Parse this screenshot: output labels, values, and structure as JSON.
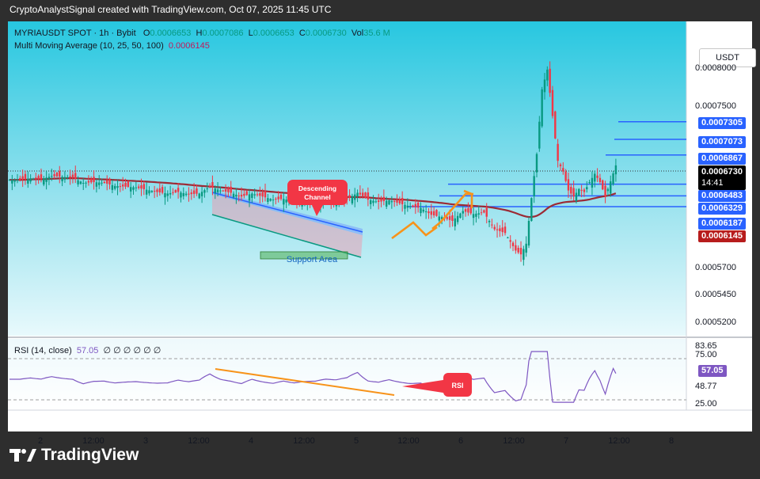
{
  "header": {
    "text": "CryptoAnalystSignal created with TradingView.com, Oct 07, 2025 11:45 UTC"
  },
  "footer": {
    "brand": "TradingView"
  },
  "legend": {
    "symbol": "MYRIAUSDT SPOT · 1h · Bybit",
    "o_label": "O",
    "o_value": "0.0006653",
    "h_label": "H",
    "h_value": "0.0007086",
    "l_label": "L",
    "l_value": "0.0006653",
    "c_label": "C",
    "c_value": "0.0006730",
    "vol_label": "Vol",
    "vol_value": "35.6 M",
    "ma_name": "Multi Moving Average (10, 25, 50, 100)",
    "ma_value": "0.0006145",
    "rsi_name": "RSI (14, close)",
    "rsi_value": "57.05",
    "rsi_extra": "∅ ∅ ∅ ∅ ∅ ∅"
  },
  "currency_button": "USDT",
  "price_axis": [
    "0.0008000",
    "0.0007500",
    "0.0005700",
    "0.0005450",
    "0.0005200"
  ],
  "price_tags": {
    "l1": "0.0007305",
    "l2": "0.0007073",
    "l3": "0.0006867",
    "current": "0.0006730",
    "countdown": "14:41",
    "l4": "0.0006483",
    "l5": "0.0006329",
    "l6": "0.0006187",
    "ma": "0.0006145"
  },
  "rsi_axis": {
    "top": "83.65",
    "upper": "75.00",
    "current": "57.05",
    "mid": "48.77",
    "lower": "25.00"
  },
  "time_axis": [
    "2",
    "12:00",
    "3",
    "12:00",
    "4",
    "12:00",
    "5",
    "12:00",
    "6",
    "12:00",
    "7",
    "12:00",
    "8"
  ],
  "annotations": {
    "descending_channel": "Descending\nChannel",
    "support_area": "Support Area",
    "rsi": "RSI"
  },
  "colors": {
    "bull": "#089981",
    "bear": "#f23645",
    "ma": "#9c2a35",
    "line": "#2962ff",
    "rsi": "#7e57c2",
    "arrow": "#f7931a",
    "callout": "#f23645"
  },
  "chart_data": {
    "type": "candlestick",
    "symbol": "MYRIAUSDT",
    "timeframe": "1h",
    "exchange": "Bybit",
    "ohlc_last": {
      "open": 0.0006653,
      "high": 0.0007086,
      "low": 0.0006653,
      "close": 0.000673
    },
    "price_series": [
      [
        0,
        0.000654
      ],
      [
        4,
        0.000654
      ],
      [
        8,
        0.000656
      ],
      [
        12,
        0.000655
      ],
      [
        16,
        0.000659
      ],
      [
        20,
        0.000658
      ],
      [
        24,
        0.000657
      ],
      [
        28,
        0.00065
      ],
      [
        32,
        0.000651
      ],
      [
        36,
        0.00065
      ],
      [
        40,
        0.000646
      ],
      [
        44,
        0.000645
      ],
      [
        48,
        0.000644
      ],
      [
        52,
        0.000641
      ],
      [
        56,
        0.000638
      ],
      [
        60,
        0.000636
      ],
      [
        64,
        0.000638
      ],
      [
        68,
        0.000635
      ],
      [
        72,
        0.000636
      ],
      [
        76,
        0.000645
      ],
      [
        80,
        0.00064
      ],
      [
        84,
        0.000637
      ],
      [
        88,
        0.000632
      ],
      [
        92,
        0.000636
      ],
      [
        96,
        0.000632
      ],
      [
        100,
        0.000628
      ],
      [
        104,
        0.000629
      ],
      [
        108,
        0.000625
      ],
      [
        112,
        0.000625
      ],
      [
        116,
        0.000624
      ],
      [
        120,
        0.000626
      ],
      [
        124,
        0.000625
      ],
      [
        128,
        0.000628
      ],
      [
        132,
        0.000637
      ],
      [
        136,
        0.000628
      ],
      [
        140,
        0.000625
      ],
      [
        144,
        0.000627
      ],
      [
        148,
        0.000623
      ],
      [
        152,
        0.000619
      ],
      [
        156,
        0.000617
      ],
      [
        160,
        0.000608
      ],
      [
        164,
        0.000605
      ],
      [
        168,
        0.0006
      ],
      [
        172,
        0.000613
      ],
      [
        176,
        0.000609
      ],
      [
        180,
        0.000611
      ],
      [
        184,
        0.000589
      ],
      [
        188,
        0.000584
      ],
      [
        192,
        0.000561
      ],
      [
        194,
        0.000556
      ],
      [
        196,
        0.00057
      ],
      [
        198,
        0.00063
      ],
      [
        200,
        0.000688
      ],
      [
        202,
        0.000773
      ],
      [
        204,
        0.000799
      ],
      [
        206,
        0.000738
      ],
      [
        208,
        0.000679
      ],
      [
        210,
        0.000665
      ],
      [
        212,
        0.00064
      ],
      [
        214,
        0.000632
      ],
      [
        216,
        0.000642
      ],
      [
        218,
        0.000638
      ],
      [
        220,
        0.000651
      ],
      [
        222,
        0.000662
      ],
      [
        224,
        0.000651
      ],
      [
        226,
        0.000632
      ],
      [
        228,
        0.000652
      ],
      [
        230,
        0.000673
      ]
    ],
    "moving_average_last": 0.0006145,
    "horizontal_levels": [
      0.0007305,
      0.0007073,
      0.0006867,
      0.0006483,
      0.0006329,
      0.0006187
    ],
    "price_axis_ticks": [
      0.0008,
      0.00075,
      0.00057,
      0.000545,
      0.00052
    ],
    "rsi": {
      "period": 14,
      "last": 57.05,
      "max": 83.65,
      "levels": [
        75,
        48.77,
        25
      ]
    },
    "x_ticks": [
      "2",
      "12:00",
      "3",
      "12:00",
      "4",
      "12:00",
      "5",
      "12:00",
      "6",
      "12:00",
      "7",
      "12:00",
      "8"
    ]
  }
}
